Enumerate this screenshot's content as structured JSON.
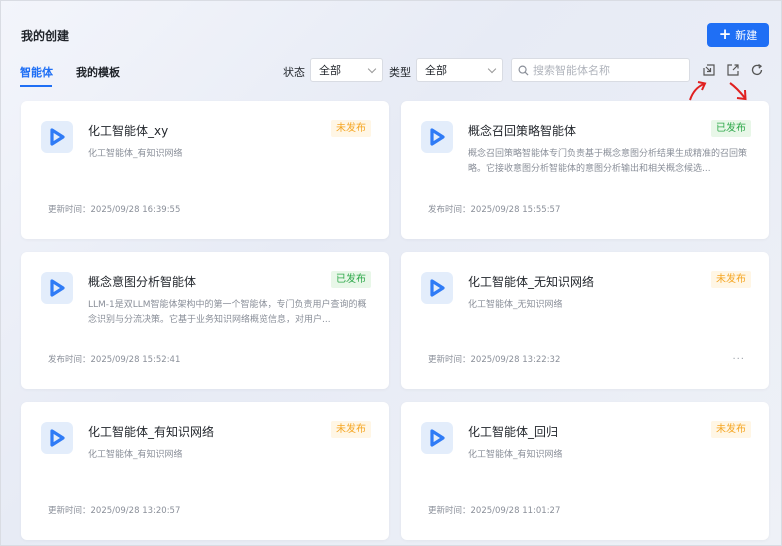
{
  "header": {
    "title": "我的创建",
    "new_button": "新建"
  },
  "tabs": [
    {
      "label": "智能体",
      "active": true
    },
    {
      "label": "我的模板",
      "active": false
    }
  ],
  "filters": {
    "status_label": "状态",
    "status_value": "全部",
    "type_label": "类型",
    "type_value": "全部",
    "search_placeholder": "搜索智能体名称"
  },
  "icons": {
    "import": "import-icon",
    "export": "export-icon",
    "refresh": "refresh-icon"
  },
  "colors": {
    "accent": "#1f6ff5",
    "unpublished": "#f5a623",
    "published": "#2ea84a",
    "annotation_arrow": "#e02020"
  },
  "cards": [
    {
      "title": "化工智能体_xy",
      "badge": "未发布",
      "status": "unpublished",
      "desc": "化工智能体_有知识网络",
      "time": "更新时间：2025/09/28 16:39:55"
    },
    {
      "title": "概念召回策略智能体",
      "badge": "已发布",
      "status": "published",
      "desc": "概念召回策略智能体专门负责基于概念意图分析结果生成精准的召回策略。它接收意图分析智能体的意图分析输出和相关概念候选...",
      "time": "发布时间：2025/09/28 15:55:57"
    },
    {
      "title": "概念意图分析智能体",
      "badge": "已发布",
      "status": "published",
      "desc": "LLM-1是双LLM智能体架构中的第一个智能体，专门负责用户查询的概念识别与分流决策。它基于业务知识网络概览信息，对用户...",
      "time": "发布时间：2025/09/28 15:52:41"
    },
    {
      "title": "化工智能体_无知识网络",
      "badge": "未发布",
      "status": "unpublished",
      "desc": "化工智能体_无知识网络",
      "time": "更新时间：2025/09/28 13:22:32",
      "more": "···"
    },
    {
      "title": "化工智能体_有知识网络",
      "badge": "未发布",
      "status": "unpublished",
      "desc": "化工智能体_有知识网络",
      "time": "更新时间：2025/09/28 13:20:57"
    },
    {
      "title": "化工智能体_回归",
      "badge": "未发布",
      "status": "unpublished",
      "desc": "化工智能体_有知识网络",
      "time": "更新时间：2025/09/28 11:01:27"
    }
  ]
}
